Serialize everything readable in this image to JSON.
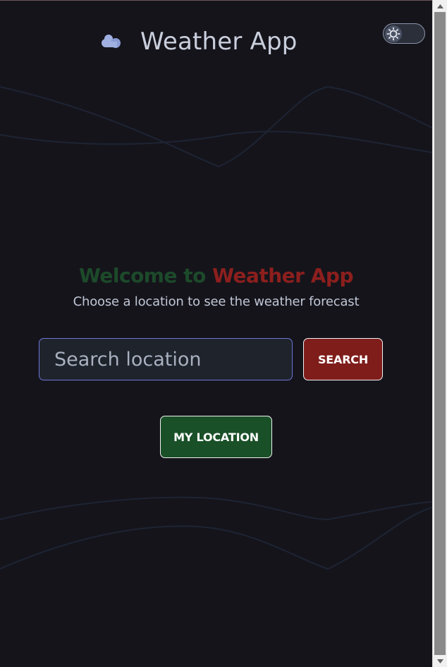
{
  "header": {
    "logo_icon": "cloud-icon",
    "title": "Weather App"
  },
  "theme_toggle": {
    "icon": "sun-icon",
    "state": "dark"
  },
  "welcome": {
    "part1": "Welcome to ",
    "part2": "Weather App",
    "subtitle": "Choose a location to see the weather forecast"
  },
  "search": {
    "placeholder": "Search location",
    "value": "",
    "button_label": "SEARCH"
  },
  "location": {
    "button_label": "MY LOCATION"
  },
  "colors": {
    "background": "#15141b",
    "search_button": "#7f1d1b",
    "location_button": "#1a5028",
    "welcome_green": "#1c4a2a",
    "welcome_red": "#8c1f1d",
    "input_border": "#6f76d8"
  }
}
